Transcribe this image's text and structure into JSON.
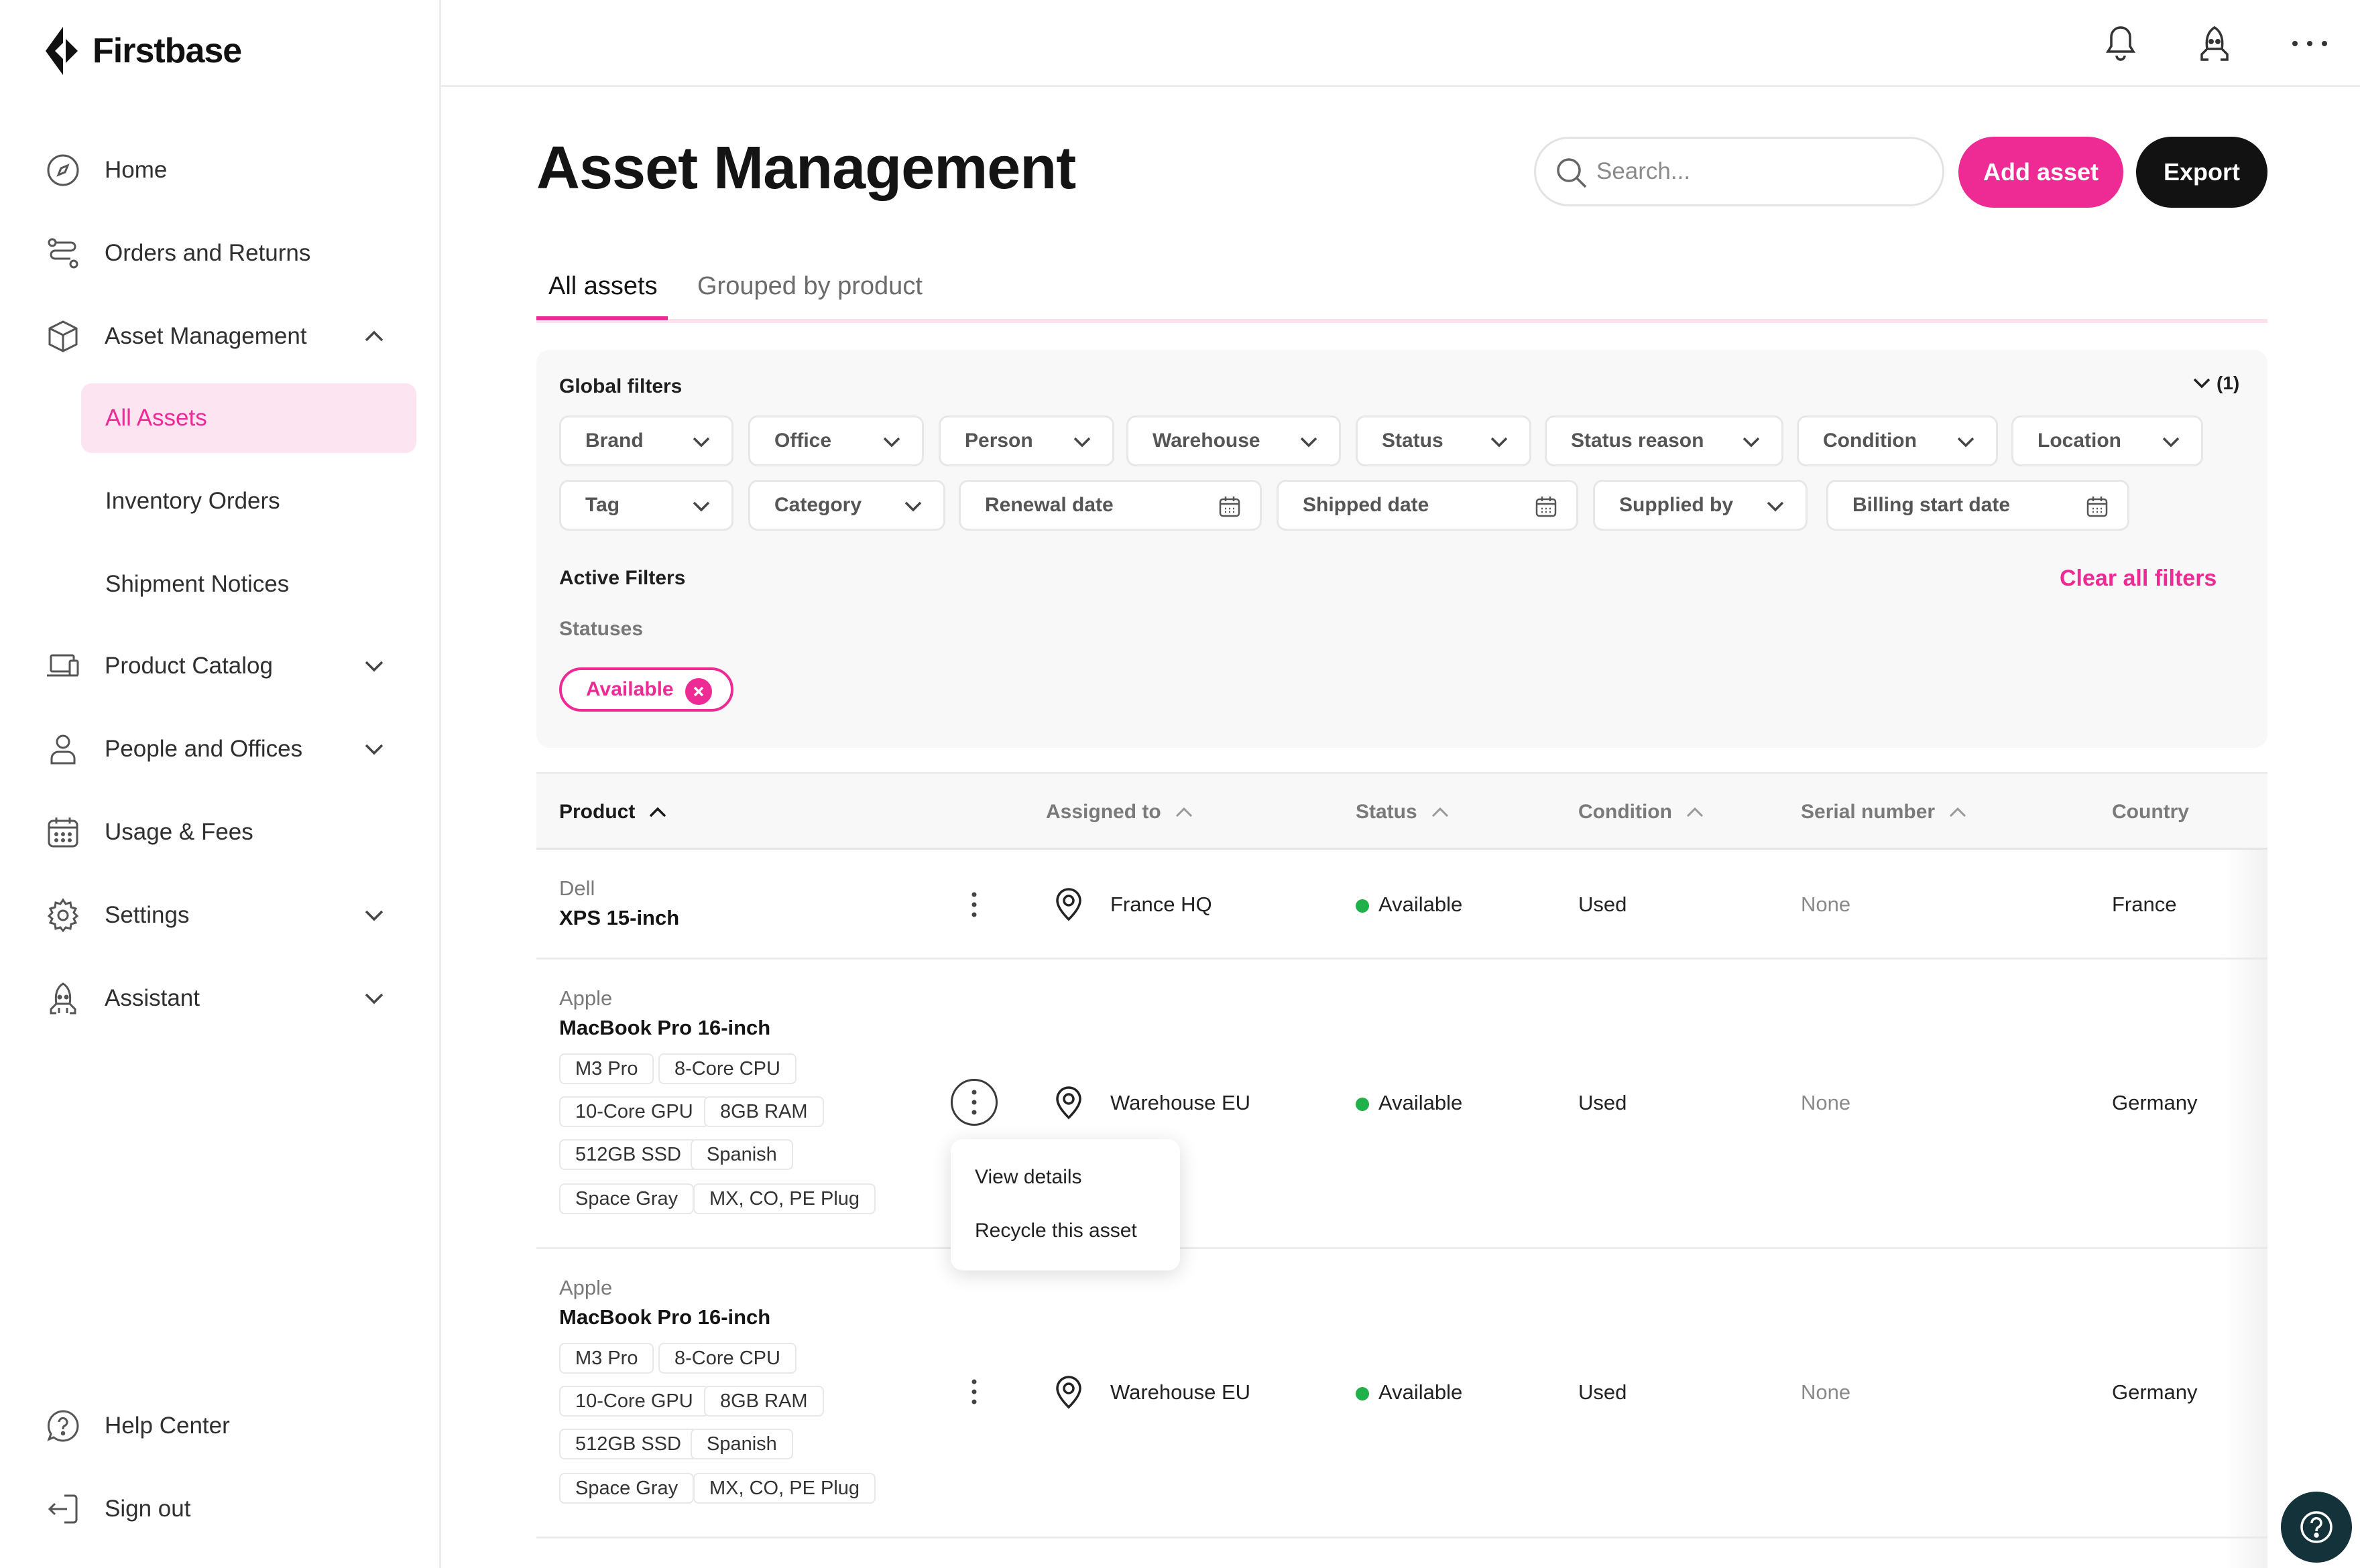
{
  "brand": {
    "name": "Firstbase"
  },
  "sidebar": {
    "items": [
      {
        "label": "Home",
        "icon": "compass-icon"
      },
      {
        "label": "Orders and Returns",
        "icon": "route-icon"
      },
      {
        "label": "Asset Management",
        "icon": "box-icon",
        "expanded": true
      },
      {
        "label": "Product Catalog",
        "icon": "laptop-icon"
      },
      {
        "label": "People and Offices",
        "icon": "person-icon"
      },
      {
        "label": "Usage & Fees",
        "icon": "calendar-icon"
      },
      {
        "label": "Settings",
        "icon": "gear-icon"
      },
      {
        "label": "Assistant",
        "icon": "robot-icon"
      }
    ],
    "sub_items": [
      {
        "label": "All Assets",
        "active": true
      },
      {
        "label": "Inventory Orders"
      },
      {
        "label": "Shipment Notices"
      }
    ],
    "footer": [
      {
        "label": "Help Center",
        "icon": "help-icon"
      },
      {
        "label": "Sign out",
        "icon": "sign-out-icon"
      }
    ]
  },
  "header": {
    "title": "Asset Management",
    "search_placeholder": "Search...",
    "add_label": "Add asset",
    "export_label": "Export"
  },
  "tabs": [
    "All assets",
    "Grouped by product"
  ],
  "filters": {
    "global_label": "Global filters",
    "collapse_count": "(1)",
    "row1": [
      "Brand",
      "Office",
      "Person",
      "Warehouse",
      "Status",
      "Status reason",
      "Condition",
      "Location"
    ],
    "row2": [
      "Tag",
      "Category",
      "Renewal date",
      "Shipped date",
      "Supplied by",
      "Billing start date"
    ],
    "active_label": "Active Filters",
    "clear_label": "Clear all filters",
    "statuses_label": "Statuses",
    "active_pill": "Available"
  },
  "table": {
    "columns": [
      "Product",
      "Assigned to",
      "Status",
      "Condition",
      "Serial number",
      "Country"
    ],
    "rows": [
      {
        "brand": "Dell",
        "product": "XPS 15-inch",
        "specs": [],
        "assigned": "France HQ",
        "status": "Available",
        "condition": "Used",
        "serial": "None",
        "country": "France"
      },
      {
        "brand": "Apple",
        "product": "MacBook Pro 16-inch",
        "specs": [
          "M3 Pro",
          "8-Core CPU",
          "10-Core GPU",
          "8GB RAM",
          "512GB SSD",
          "Spanish",
          "Space Gray",
          "MX, CO, PE Plug"
        ],
        "assigned": "Warehouse EU",
        "status": "Available",
        "condition": "Used",
        "serial": "None",
        "country": "Germany"
      },
      {
        "brand": "Apple",
        "product": "MacBook Pro 16-inch",
        "specs": [
          "M3 Pro",
          "8-Core CPU",
          "10-Core GPU",
          "8GB RAM",
          "512GB SSD",
          "Spanish",
          "Space Gray",
          "MX, CO, PE Plug"
        ],
        "assigned": "Warehouse EU",
        "status": "Available",
        "condition": "Used",
        "serial": "None",
        "country": "Germany"
      }
    ]
  },
  "row_menu": {
    "items": [
      "View details",
      "Recycle this asset"
    ]
  },
  "colors": {
    "accent": "#ee2a95",
    "status_green": "#1fb24a",
    "dark": "#121212",
    "fab": "#13323a"
  }
}
